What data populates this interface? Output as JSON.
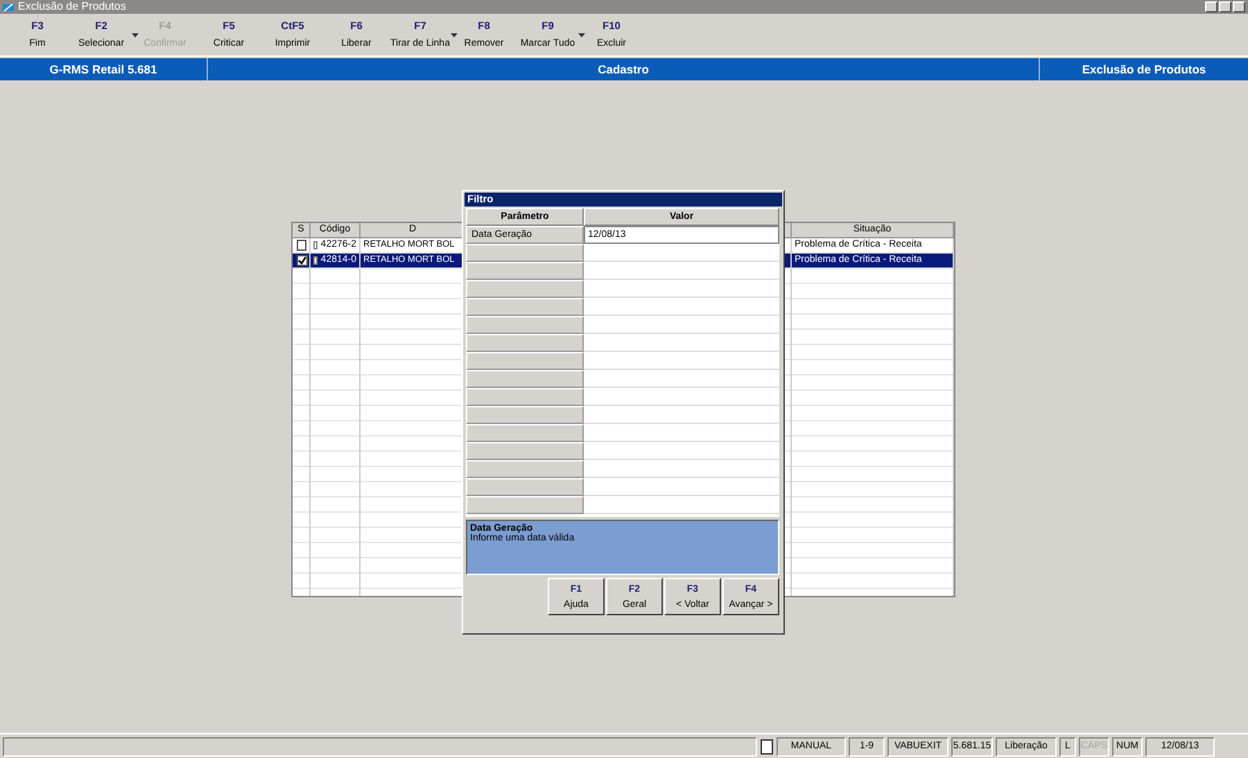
{
  "window": {
    "title": "Exclusão de Produtos"
  },
  "toolbar": [
    {
      "key": "F3",
      "label": "Fim",
      "disabled": false,
      "dropdown": false
    },
    {
      "key": "F2",
      "label": "Selecionar",
      "disabled": false,
      "dropdown": true
    },
    {
      "key": "F4",
      "label": "Confirmar",
      "disabled": true,
      "dropdown": false
    },
    {
      "key": "F5",
      "label": "Criticar",
      "disabled": false,
      "dropdown": false
    },
    {
      "key": "CtF5",
      "label": "Imprimir",
      "disabled": false,
      "dropdown": false
    },
    {
      "key": "F6",
      "label": "Liberar",
      "disabled": false,
      "dropdown": false
    },
    {
      "key": "F7",
      "label": "Tirar de Linha",
      "disabled": false,
      "dropdown": true
    },
    {
      "key": "F8",
      "label": "Remover",
      "disabled": false,
      "dropdown": false
    },
    {
      "key": "F9",
      "label": "Marcar Tudo",
      "disabled": false,
      "dropdown": true
    },
    {
      "key": "F10",
      "label": "Excluir",
      "disabled": false,
      "dropdown": false
    }
  ],
  "header": {
    "app": "G-RMS Retail 5.681",
    "module": "Cadastro",
    "screen": "Exclusão de Produtos"
  },
  "table": {
    "columns": [
      "S",
      "Código",
      "D",
      "Situação"
    ],
    "rows": [
      {
        "checked": false,
        "selected": false,
        "code": "42276-2",
        "column_3": "RETALHO MORT BOL",
        "status": "Problema de Crítica - Receita"
      },
      {
        "checked": true,
        "selected": true,
        "code": "42814-0",
        "column_3": "RETALHO MORT BOL",
        "status": "Problema de Crítica - Receita"
      }
    ]
  },
  "dialog": {
    "title": "Filtro",
    "columns": [
      "Parâmetro",
      "Valor"
    ],
    "params": [
      {
        "name": "Data Geração",
        "value": "12/08/13",
        "selected": true
      }
    ],
    "help": {
      "title": "Data Geração",
      "text": "Informe uma data válida"
    },
    "buttons": [
      {
        "key": "F1",
        "label": "Ajuda"
      },
      {
        "key": "F2",
        "label": "Geral"
      },
      {
        "key": "F3",
        "label": "< Voltar"
      },
      {
        "key": "F4",
        "label": "Avançar >"
      }
    ]
  },
  "status_bar": [
    {
      "text": "MANUAL",
      "disabled": false
    },
    {
      "text": "1-9",
      "disabled": false
    },
    {
      "text": "VABUEXIT",
      "disabled": false
    },
    {
      "text": "5.681.15",
      "disabled": false
    },
    {
      "text": "Liberação",
      "disabled": false
    },
    {
      "text": "L",
      "disabled": false
    },
    {
      "text": "CAPS",
      "disabled": true
    },
    {
      "text": "NUM",
      "disabled": false
    },
    {
      "text": "12/08/13",
      "disabled": false
    }
  ]
}
